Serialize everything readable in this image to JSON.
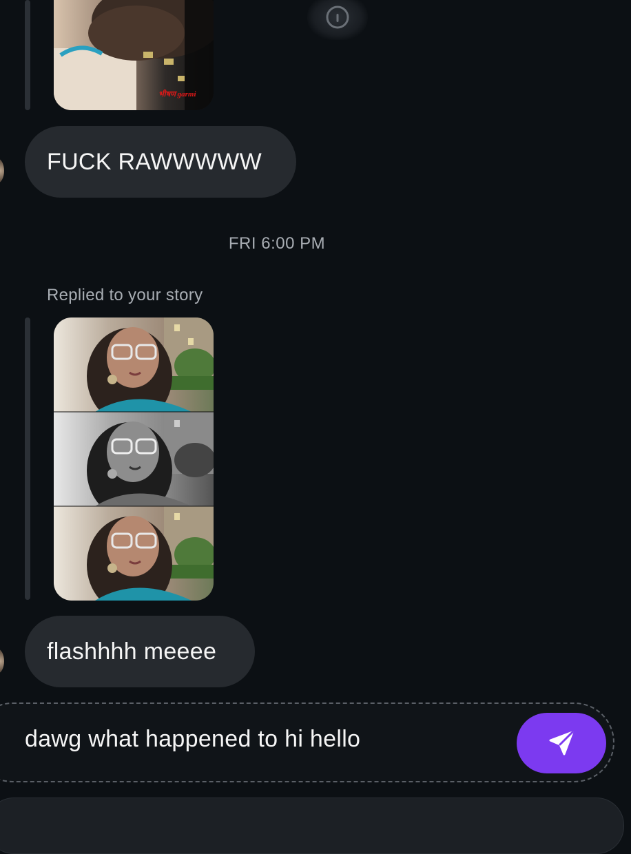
{
  "messages": {
    "first": "FUCK RAWWWWW",
    "second": "flashhhh meeee"
  },
  "story_sticker_text": "भीषण garmi",
  "timestamp": "FRI 6:00 PM",
  "reply_label": "Replied to your story",
  "composer": {
    "text": "dawg what happened to hi hello"
  },
  "colors": {
    "background": "#0c1014",
    "bubble": "#262a2f",
    "send_button": "#7c3af0",
    "muted_text": "#a8adb3"
  },
  "icons": {
    "info": "info-icon",
    "send": "paper-plane-icon"
  }
}
